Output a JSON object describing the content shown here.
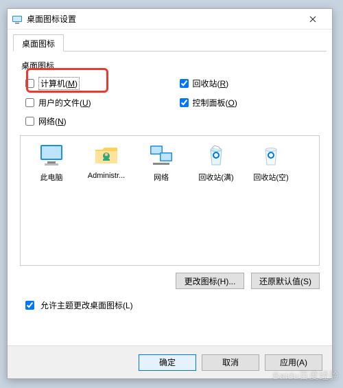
{
  "window": {
    "title": "桌面图标设置"
  },
  "tab": {
    "label": "桌面图标"
  },
  "group": {
    "label": "桌面图标"
  },
  "checks": {
    "computer": {
      "label": "计算机(",
      "accel": "M",
      "tail": ")",
      "checked": false
    },
    "recycle": {
      "label": "回收站(",
      "accel": "R",
      "tail": ")",
      "checked": true
    },
    "userfiles": {
      "label": "用户的文件(",
      "accel": "U",
      "tail": ")",
      "checked": false
    },
    "control": {
      "label": "控制面板(",
      "accel": "O",
      "tail": ")",
      "checked": true
    },
    "network": {
      "label": "网络(",
      "accel": "N",
      "tail": ")",
      "checked": false
    }
  },
  "icons": {
    "thispc": "此电脑",
    "admin": "Administr...",
    "network": "网络",
    "bin_full": "回收站(满)",
    "bin_empty": "回收站(空)"
  },
  "buttons": {
    "change_icon": "更改图标(H)...",
    "restore_default": "还原默认值(S)",
    "ok": "确定",
    "cancel": "取消",
    "apply": "应用(A)"
  },
  "theme_checkbox": {
    "label": "允许主题更改桌面图标(L)",
    "checked": true
  },
  "watermark": "Baidu百度经验"
}
